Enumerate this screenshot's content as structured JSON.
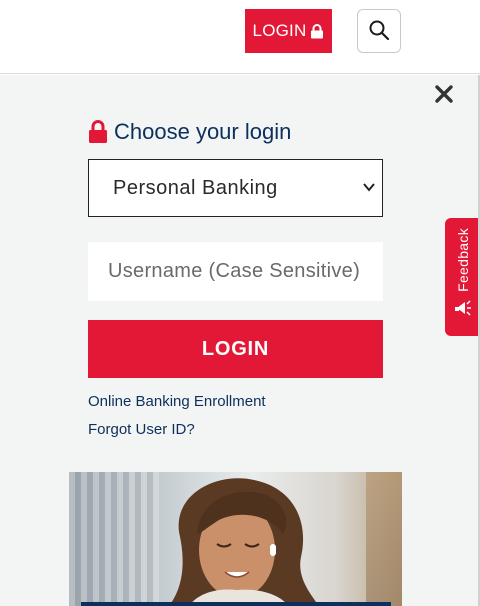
{
  "header": {
    "login_label": "LOGIN",
    "login_icon": "lock-icon",
    "search_icon": "search-icon"
  },
  "panel": {
    "close_icon": "close-icon",
    "title": "Choose your login",
    "title_icon": "lock-icon",
    "account_type": {
      "selected": "Personal Banking"
    },
    "username": {
      "placeholder": "Username (Case Sensitive)"
    },
    "login_button": "LOGIN",
    "links": {
      "enroll": "Online Banking Enrollment",
      "forgot": "Forgot User ID?"
    }
  },
  "feedback": {
    "label": "Feedback",
    "icon": "megaphone-icon"
  },
  "colors": {
    "brand_red": "#e31837",
    "navy": "#0c2f5c",
    "panel_bg": "#f3f5f4"
  }
}
